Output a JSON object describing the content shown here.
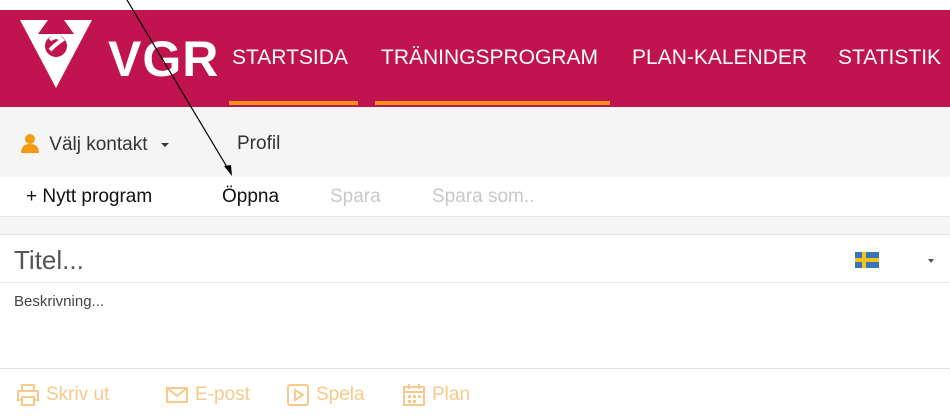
{
  "brand": {
    "logo_text": "VGR",
    "primary_color": "#c0134f",
    "accent_color": "#f3931a"
  },
  "nav": {
    "items": [
      {
        "label": "STARTSIDA",
        "active": true
      },
      {
        "label": "TRÄNINGSPROGRAM",
        "active": true
      },
      {
        "label": "PLAN-KALENDER",
        "active": false
      },
      {
        "label": "STATISTIK",
        "active": false
      }
    ]
  },
  "contact": {
    "select_label": "Välj kontakt",
    "profile_label": "Profil"
  },
  "toolbar": {
    "new_program": "+ Nytt program",
    "open": "Öppna",
    "save": "Spara",
    "save_as": "Spara som.."
  },
  "editor": {
    "title_placeholder": "Titel...",
    "description_placeholder": "Beskrivning...",
    "language_icon": "swedish-flag-icon"
  },
  "actions": {
    "print": "Skriv ut",
    "email": "E-post",
    "play": "Spela",
    "plan": "Plan"
  }
}
